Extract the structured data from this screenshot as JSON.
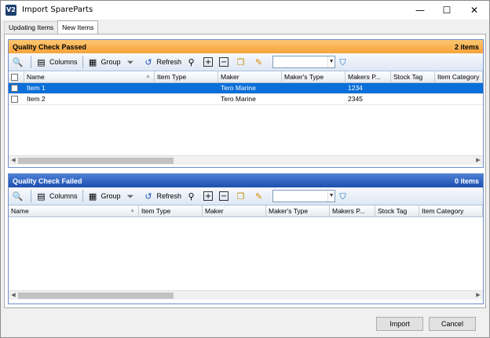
{
  "window": {
    "title": "Import SpareParts",
    "icon_label": "V2",
    "minimize": "—",
    "maximize": "☐",
    "close": "✕"
  },
  "tabs": [
    {
      "label": "Updating Items"
    },
    {
      "label": "New Items"
    }
  ],
  "toolbar": {
    "columns": "Columns",
    "group": "Group",
    "refresh": "Refresh",
    "combo_value": ""
  },
  "passed": {
    "title": "Quality Check Passed",
    "count": "2 items",
    "color": "#f6a33a",
    "columns": [
      "Name",
      "Item Type",
      "Maker",
      "Maker's Type",
      "Makers P...",
      "Stock Tag",
      "Item Category"
    ],
    "rows": [
      {
        "name": "Item 1",
        "item_type": "",
        "maker": "Tero Marine",
        "makers_type": "",
        "makers_p": "1234",
        "stock_tag": "",
        "item_category": "",
        "selected": true
      },
      {
        "name": "Item 2",
        "item_type": "",
        "maker": "Tero Marine",
        "makers_type": "",
        "makers_p": "2345",
        "stock_tag": "",
        "item_category": "",
        "selected": false
      }
    ]
  },
  "failed": {
    "title": "Quality Check Failed",
    "count": "0 items",
    "color": "#1d4fae",
    "columns": [
      "Name",
      "Item Type",
      "Maker",
      "Maker's Type",
      "Makers P...",
      "Stock Tag",
      "Item Category"
    ]
  },
  "footer": {
    "import": "Import",
    "cancel": "Cancel"
  },
  "icons": {
    "zoom": "zoom-icon",
    "columns": "columns-icon",
    "group": "group-icon",
    "filter": "filter-icon",
    "refresh": "refresh-icon",
    "find": "binoculars-icon",
    "expand": "expand-icon",
    "collapse": "collapse-icon",
    "copy": "copy-icon",
    "edit": "pencil-icon",
    "save": "save-filter-icon"
  }
}
